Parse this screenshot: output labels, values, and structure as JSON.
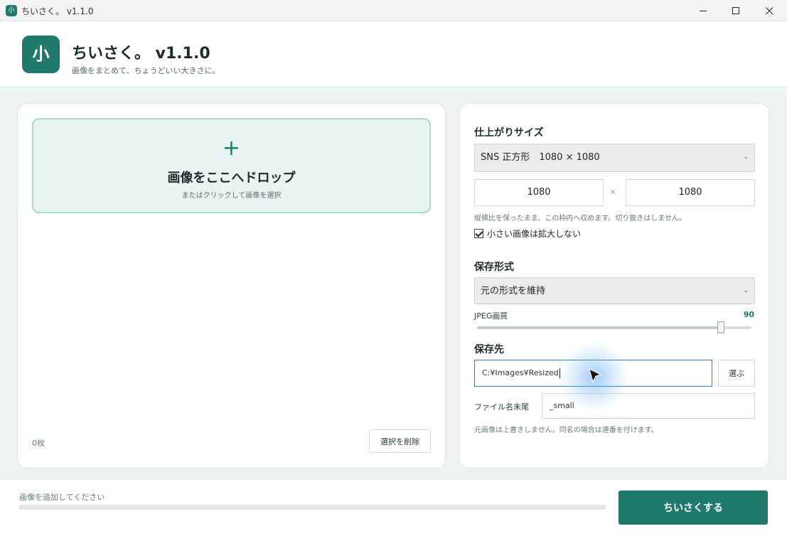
{
  "window": {
    "title": "ちいさく。 v1.1.0",
    "icon_text": "小"
  },
  "header": {
    "logo_text": "小",
    "title": "ちいさく。 v1.1.0",
    "subtitle": "画像をまとめて、ちょうどいい大きさに。"
  },
  "dropzone": {
    "plus": "+",
    "title": "画像をここへドロップ",
    "subtitle": "またはクリックして画像を選択"
  },
  "file_list": {
    "count": "0枚",
    "delete_label": "選択を削除"
  },
  "size": {
    "label": "仕上がりサイズ",
    "preset": "SNS 正方形　1080 × 1080",
    "width": "1080",
    "height": "1080",
    "times": "×",
    "hint": "縦横比を保ったまま、この枠内へ収めます。切り抜きはしません。",
    "no_enlarge_label": "小さい画像は拡大しない",
    "no_enlarge_checked": true
  },
  "format": {
    "label": "保存形式",
    "selected": "元の形式を維持",
    "quality_label": "JPEG画質",
    "quality_value": "90",
    "quality_min": 1,
    "quality_max": 100
  },
  "destination": {
    "label": "保存先",
    "path": "C:¥Images¥Resized",
    "choose_label": "選ぶ",
    "suffix_label": "ファイル名末尾",
    "suffix_value": "_small",
    "hint": "元画像は上書きしません。同名の場合は連番を付けます。"
  },
  "footer": {
    "status": "画像を追加してください",
    "progress": 0,
    "run_label": "ちいさくする"
  },
  "colors": {
    "accent": "#1f7a6d",
    "dropzone_bg": "#e8f4f2",
    "dropzone_border": "#a9d6cf",
    "focus_border": "#2b7fc3"
  },
  "icons": {
    "minimize": "minimize-icon",
    "maximize": "maximize-icon",
    "close": "close-icon",
    "dropdown": "chevron-down-icon",
    "cursor": "mouse-pointer-icon"
  }
}
